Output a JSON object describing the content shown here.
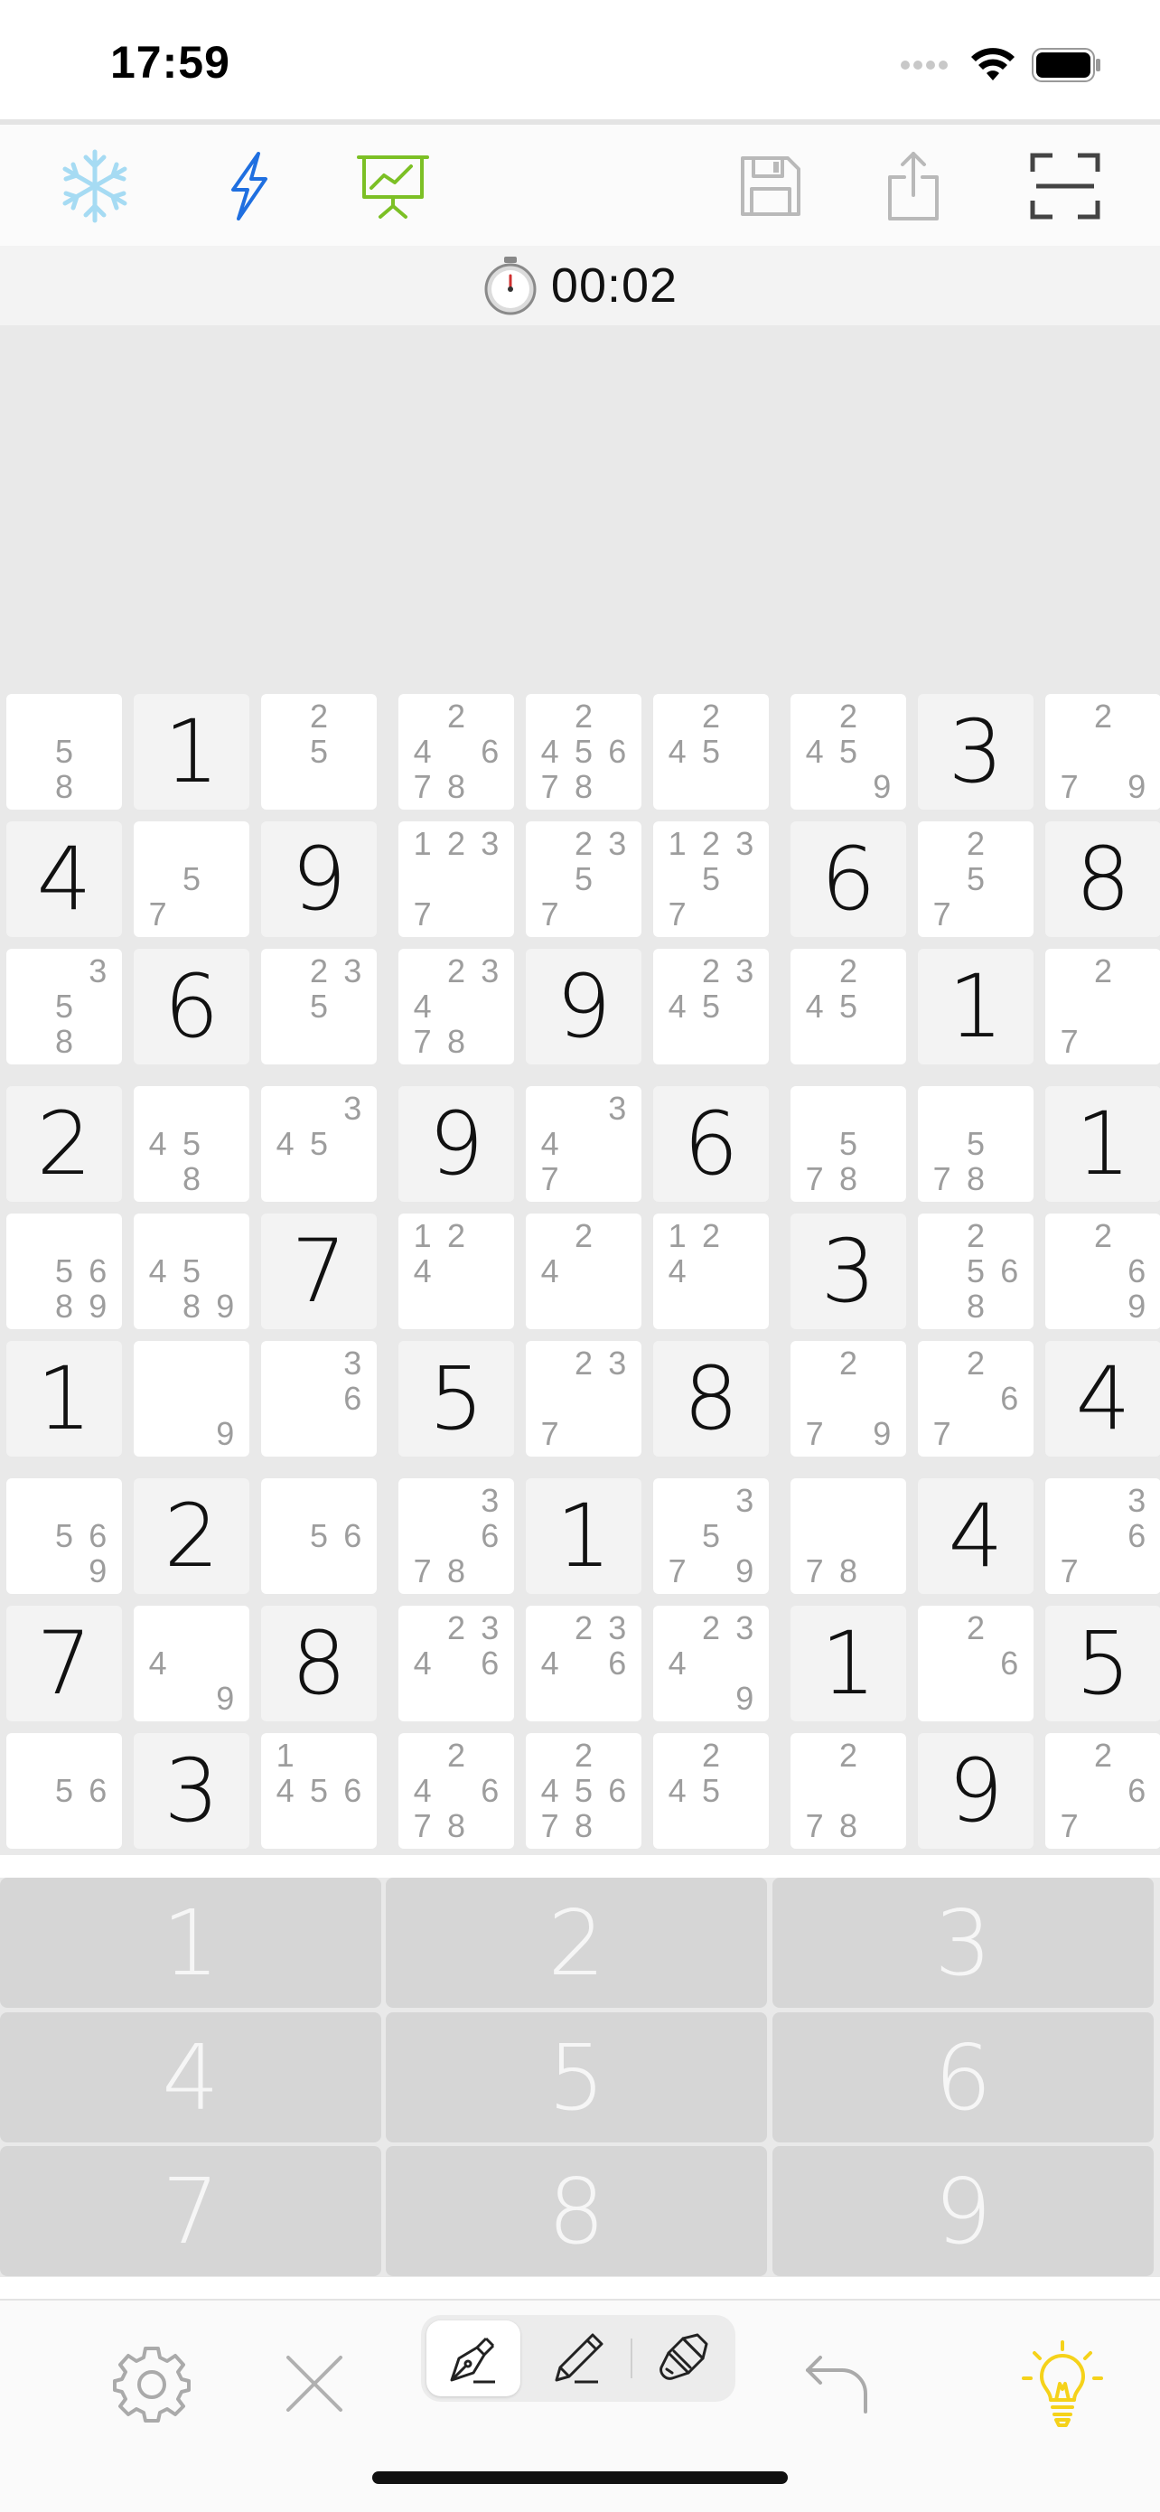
{
  "status_bar": {
    "time": "17:59",
    "icons": [
      "cellular-icon",
      "wifi-icon",
      "battery-icon"
    ]
  },
  "toolbar": {
    "left_icons": [
      "snowflake-icon",
      "lightning-icon",
      "chart-presentation-icon"
    ],
    "right_icons": [
      "save-icon",
      "share-icon",
      "fullscreen-icon"
    ],
    "colors": {
      "snowflake": "#a6dbf3",
      "lightning": "#1f6fe0",
      "chart": "#7cc025",
      "gray": "#b9b9b9"
    }
  },
  "timer": {
    "icon": "stopwatch-icon",
    "text": "00:02"
  },
  "board": {
    "rows": [
      [
        "c:58",
        "1",
        "c:25",
        "c:24678",
        "c:245678",
        "c:245",
        "c:2459",
        "3",
        "c:279"
      ],
      [
        "4",
        "c:57",
        "9",
        "c:1237",
        "c:2357",
        "c:12357",
        "6",
        "c:257",
        "8"
      ],
      [
        "c:358",
        "6",
        "c:235",
        "c:23478",
        "9",
        "c:2345",
        "c:245",
        "1",
        "c:27"
      ],
      [
        "2",
        "c:458",
        "c:345",
        "9",
        "c:347",
        "6",
        "c:578",
        "c:578",
        "1"
      ],
      [
        "c:5689",
        "c:4589",
        "7",
        "c:124",
        "c:24",
        "c:124",
        "3",
        "c:2568",
        "c:269"
      ],
      [
        "1",
        "c:9",
        "c:36",
        "5",
        "c:237",
        "8",
        "c:279",
        "c:267",
        "4"
      ],
      [
        "c:569",
        "2",
        "c:56",
        "c:3678",
        "1",
        "c:3579",
        "c:78",
        "4",
        "c:367"
      ],
      [
        "7",
        "c:49",
        "8",
        "c:2346",
        "c:2346",
        "c:2349",
        "1",
        "c:26",
        "5"
      ],
      [
        "c:56",
        "3",
        "c:1456",
        "c:24678",
        "c:245678",
        "c:245",
        "c:278",
        "9",
        "c:267"
      ]
    ]
  },
  "keypad": {
    "keys": [
      "1",
      "2",
      "3",
      "4",
      "5",
      "6",
      "7",
      "8",
      "9"
    ]
  },
  "bottom_bar": {
    "icons": [
      "gear-icon",
      "close-icon",
      "pen-icon",
      "pencil-icon",
      "paintbrush-icon",
      "undo-icon",
      "lightbulb-icon"
    ],
    "active_mode": "pen",
    "lightbulb_color": "#f5d21a"
  }
}
